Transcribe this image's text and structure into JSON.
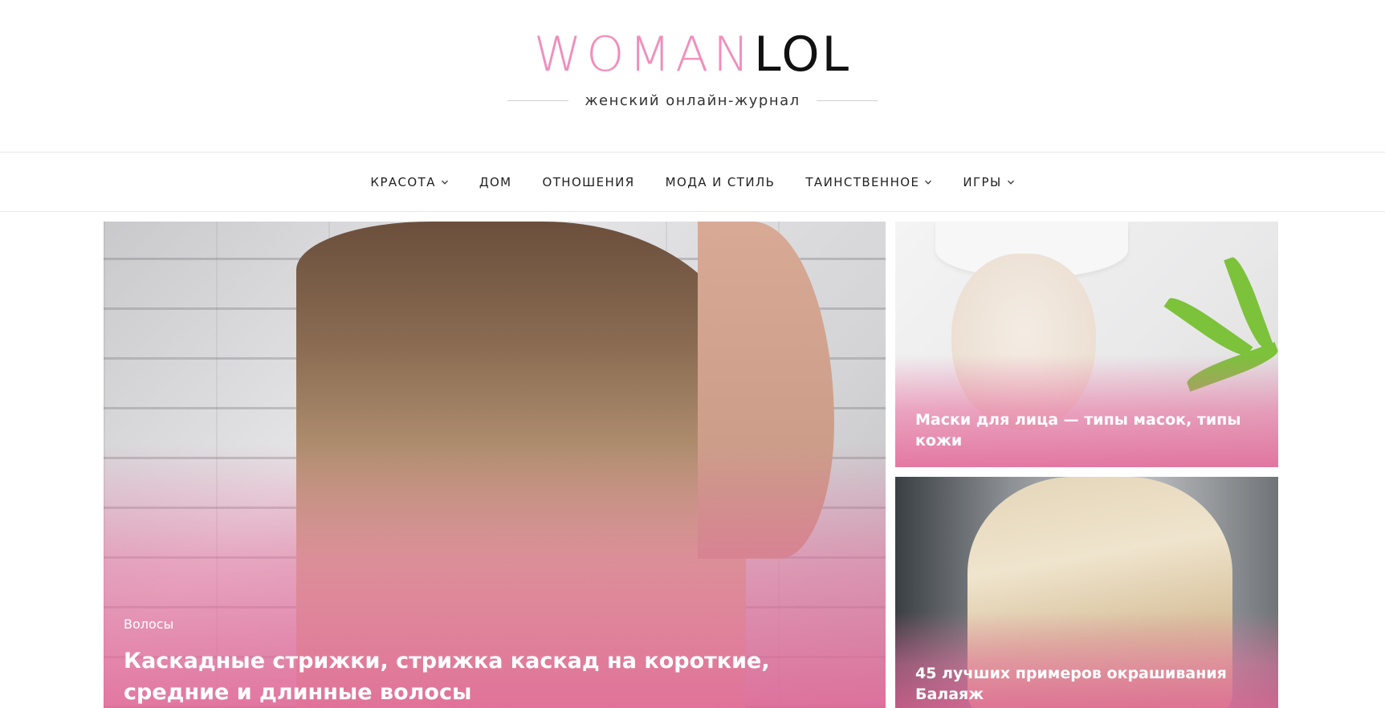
{
  "header": {
    "logo_part1": "WOMAN",
    "logo_part2": "LOL",
    "tagline": "женский онлайн-журнал",
    "colors": {
      "logo_pink": "#f08fbb",
      "logo_dark": "#111111"
    }
  },
  "nav": {
    "items": [
      {
        "label": "КРАСОТА",
        "has_dropdown": true
      },
      {
        "label": "ДОМ",
        "has_dropdown": false
      },
      {
        "label": "ОТНОШЕНИЯ",
        "has_dropdown": false
      },
      {
        "label": "МОДА И СТИЛЬ",
        "has_dropdown": false
      },
      {
        "label": "ТАИНСТВЕННОЕ",
        "has_dropdown": true
      },
      {
        "label": "ИГРЫ",
        "has_dropdown": true
      }
    ],
    "dropdown_icon": "chevron-down-icon"
  },
  "featured": {
    "main": {
      "category": "Волосы",
      "title": "Каскадные стрижки, стрижка каскад на короткие, средние и длинные волосы"
    },
    "side": [
      {
        "title": "Маски для лица — типы масок, типы кожи"
      },
      {
        "title": "45 лучших примеров окрашивания Балаяж"
      }
    ],
    "overlay_color": "#e8709f"
  }
}
